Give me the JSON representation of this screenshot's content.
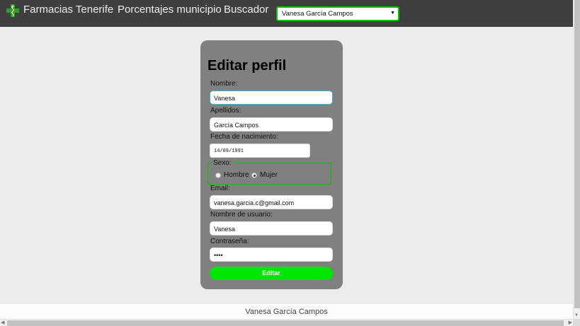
{
  "nav": {
    "brand": "Farmacias Tenerife",
    "links": [
      "Porcentajes municipio",
      "Buscador"
    ],
    "user_select": "Vanesa García Campos",
    "brand_color": "#2e9e2e",
    "accent_color": "#00c800"
  },
  "form": {
    "title": "Editar perfil",
    "nombre": {
      "label": "Nombre:",
      "value": "Vanesa"
    },
    "apellidos": {
      "label": "Apellidos:",
      "value": "García Campos"
    },
    "fecha": {
      "label": "Fecha de nacimiento:",
      "value": "14/09/1991"
    },
    "sexo": {
      "legend": "Sexo:",
      "options": [
        "Hombre",
        "Mujer"
      ],
      "selected": "Mujer"
    },
    "email": {
      "label": "Email:",
      "value": "vanesa.garcia.c@gmail.com"
    },
    "usuario": {
      "label": "Nombre de usuario:",
      "value": "Vanesa"
    },
    "password": {
      "label": "Contraseña:",
      "value": "••••"
    },
    "submit_label": "Editar",
    "submit_color": "#00e600"
  },
  "footer": {
    "text": "Vanesa García Campos"
  }
}
